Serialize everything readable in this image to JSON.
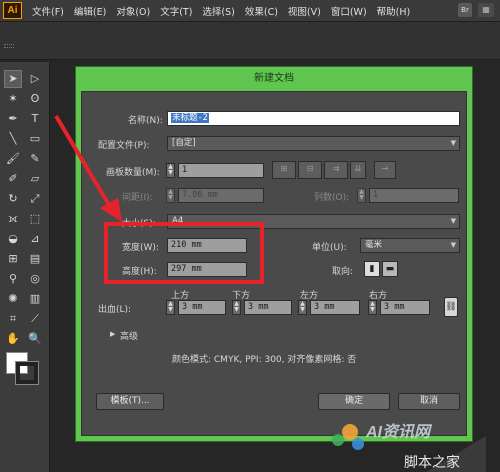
{
  "app": {
    "logo": "Ai"
  },
  "menubar": {
    "items": [
      "文件(F)",
      "编辑(E)",
      "对象(O)",
      "文字(T)",
      "选择(S)",
      "效果(C)",
      "视图(V)",
      "窗口(W)",
      "帮助(H)"
    ],
    "bridge_label": "Br",
    "arrange_label": "▦"
  },
  "tools": {
    "icons": [
      "selection-arrow-icon",
      "direct-selection-icon",
      "magic-wand-icon",
      "lasso-icon",
      "pen-icon",
      "type-icon",
      "line-icon",
      "rectangle-icon",
      "paintbrush-icon",
      "pencil-icon",
      "blob-brush-icon",
      "eraser-icon",
      "rotate-icon",
      "scale-icon",
      "width-icon",
      "free-transform-icon",
      "shape-builder-icon",
      "perspective-icon",
      "mesh-icon",
      "gradient-icon",
      "eyedropper-icon",
      "blend-icon",
      "symbol-sprayer-icon",
      "column-graph-icon",
      "artboard-icon",
      "slice-icon",
      "hand-icon",
      "zoom-icon"
    ]
  },
  "dialog": {
    "title": "新建文档",
    "name_label": "名称(N):",
    "name_value": "未标题-2",
    "profile_label": "配置文件(P):",
    "profile_value": "[自定]",
    "artboards_label": "画板数量(M):",
    "artboards_value": "1",
    "spacing_label": "间距(I):",
    "spacing_value": "7.06 mm",
    "columns_label": "列数(O):",
    "columns_value": "1",
    "size_label": "大小(S):",
    "size_value": "A4",
    "width_label": "宽度(W):",
    "width_value": "210 mm",
    "height_label": "高度(H):",
    "height_value": "297 mm",
    "units_label": "单位(U):",
    "units_value": "毫米",
    "orientation_label": "取向:",
    "bleed_label": "出血(L):",
    "bleed": {
      "top_label": "上方",
      "top_value": "3 mm",
      "bottom_label": "下方",
      "bottom_value": "3 mm",
      "left_label": "左方",
      "left_value": "3 mm",
      "right_label": "右方",
      "right_value": "3 mm"
    },
    "advanced_label": "高级",
    "info_text": "颜色模式: CMYK, PPI: 300, 对齐像素网格: 否",
    "templates_button": "模板(T)...",
    "ok_button": "确定",
    "cancel_button": "取消"
  },
  "watermark": {
    "brand": "AI资讯网",
    "site": "脚本之家"
  },
  "colors": {
    "dialog_title_bg": "#61c64f",
    "highlight": "#e8222a",
    "panel_bg": "#4a4a4a"
  }
}
